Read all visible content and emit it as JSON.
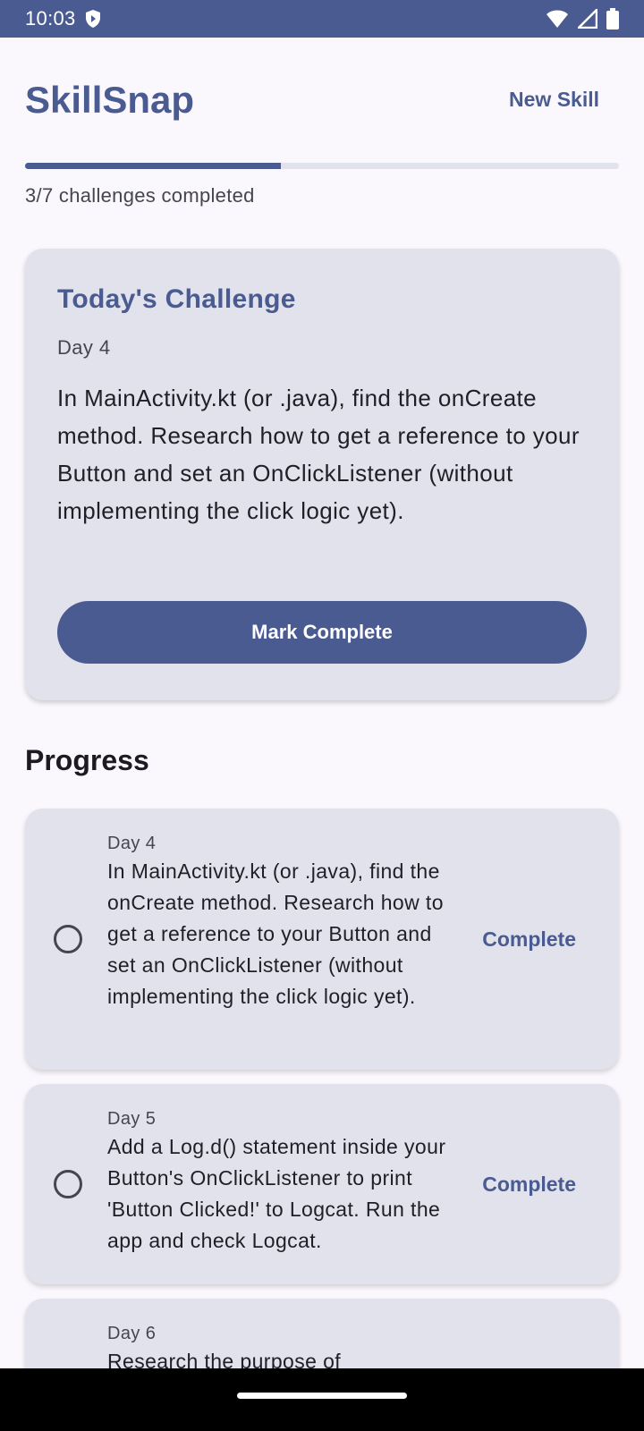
{
  "status_bar": {
    "time": "10:03",
    "icons": [
      "shield-icon",
      "wifi-icon",
      "signal-icon",
      "battery-icon"
    ]
  },
  "header": {
    "title": "SkillSnap",
    "new_skill_label": "New Skill"
  },
  "progress": {
    "completed": 3,
    "total": 7,
    "fraction": 0.43,
    "label": "3/7 challenges completed"
  },
  "today": {
    "title": "Today's Challenge",
    "day": "Day 4",
    "description": "In MainActivity.kt (or .java), find the onCreate method. Research how to get a reference to your Button and set an OnClickListener (without implementing the click logic yet).",
    "button_label": "Mark Complete"
  },
  "progress_section": {
    "heading": "Progress",
    "items": [
      {
        "day": "Day 4",
        "description": "In MainActivity.kt (or .java), find the onCreate method. Research how to get a reference to your Button and set an OnClickListener (without implementing the click logic yet).",
        "action": "Complete"
      },
      {
        "day": "Day 5",
        "description": "Add a Log.d() statement inside your Button's OnClickListener to print 'Button Clicked!' to Logcat. Run the app and check Logcat.",
        "action": "Complete"
      },
      {
        "day": "Day 6",
        "description": "Research the purpose of",
        "action": ""
      }
    ]
  },
  "colors": {
    "primary": "#4a5b91",
    "card": "#e2e2ec",
    "background": "#fbf8fd"
  }
}
